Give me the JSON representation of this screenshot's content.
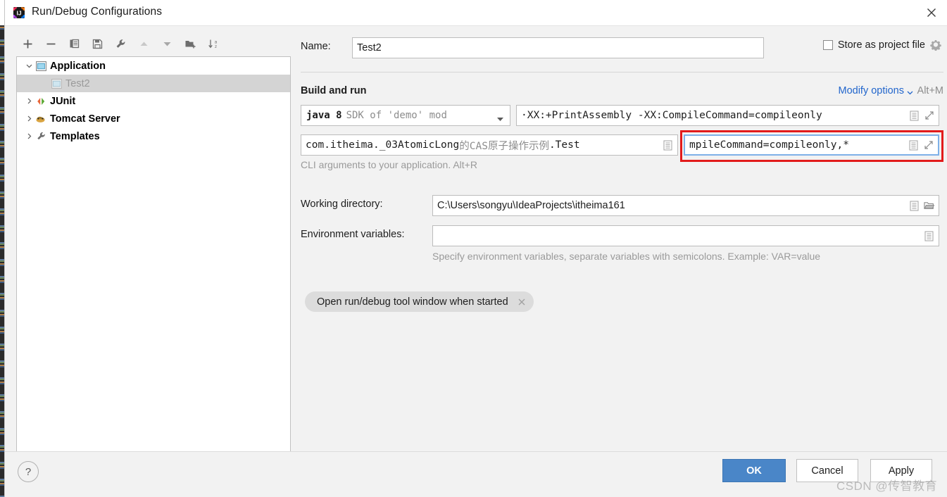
{
  "window": {
    "title": "Run/Debug Configurations",
    "app_icon": "intellij-idea-logo",
    "close_icon": "close-icon"
  },
  "toolbar": {
    "buttons": [
      {
        "name": "add-configuration-button",
        "icon": "plus-icon",
        "enabled": true
      },
      {
        "name": "remove-configuration-button",
        "icon": "minus-icon",
        "enabled": true
      },
      {
        "name": "copy-configuration-button",
        "icon": "copy-icon",
        "enabled": true
      },
      {
        "name": "save-configuration-button",
        "icon": "save-icon",
        "enabled": true
      },
      {
        "name": "edit-templates-button",
        "icon": "wrench-icon",
        "enabled": true
      },
      {
        "name": "move-up-button",
        "icon": "arrow-up-icon",
        "enabled": false
      },
      {
        "name": "move-down-button",
        "icon": "arrow-down-icon",
        "enabled": true
      },
      {
        "name": "new-folder-button",
        "icon": "folder-add-icon",
        "enabled": true
      },
      {
        "name": "sort-configurations-button",
        "icon": "sort-alpha-icon",
        "enabled": true
      }
    ]
  },
  "tree": {
    "items": [
      {
        "label": "Application",
        "icon": "application-icon",
        "expanded": true,
        "level": 0,
        "selected": false,
        "has_toggle": true
      },
      {
        "label": "Test2",
        "icon": "application-icon",
        "level": 1,
        "selected": true,
        "has_toggle": false
      },
      {
        "label": "JUnit",
        "icon": "junit-icon",
        "expanded": false,
        "level": 0,
        "selected": false,
        "has_toggle": true
      },
      {
        "label": "Tomcat Server",
        "icon": "tomcat-icon",
        "expanded": false,
        "level": 0,
        "selected": false,
        "has_toggle": true
      },
      {
        "label": "Templates",
        "icon": "wrench-icon",
        "expanded": false,
        "level": 0,
        "selected": false,
        "has_toggle": true
      }
    ]
  },
  "form": {
    "name_label": "Name:",
    "name_value": "Test2",
    "store_as_project_file_label": "Store as project file",
    "store_as_project_file_checked": false,
    "store_gear_icon": "gear-icon",
    "section_title": "Build and run",
    "modify_options_label": "Modify options",
    "modify_options_shortcut": "Alt+M",
    "jdk_value_strong": "java 8",
    "jdk_value_dim": "SDK of 'demo' mod",
    "vm_options_value": "·XX:+PrintAssembly -XX:CompileCommand=compileonly",
    "main_class_value_1": "com.itheima._03AtomicLong",
    "main_class_value_cjk": "的CAS原子操作示例",
    "main_class_value_2": ".Test",
    "program_arguments_value": "mpileCommand=compileonly,*",
    "cli_hint": "CLI arguments to your application. Alt+R",
    "working_directory_label": "Working directory:",
    "working_directory_value": "C:\\Users\\songyu\\IdeaProjects\\itheima161",
    "environment_variables_label": "Environment variables:",
    "environment_variables_value": "",
    "environment_hint": "Specify environment variables, separate variables with semicolons. Example: VAR=value",
    "chip_label": "Open run/debug tool window when started",
    "chip_close_icon": "close-small-icon",
    "expand_icon": "expand-icon",
    "list_icon": "list-icon",
    "browse_icon": "folder-browse-icon"
  },
  "footer": {
    "help_label": "?",
    "ok_label": "OK",
    "cancel_label": "Cancel",
    "apply_label": "Apply"
  },
  "watermark": "CSDN @传智教育",
  "colors": {
    "accent_blue": "#4a86c8",
    "link_blue": "#2266cc",
    "annotation_red": "#e21b1b",
    "focus_blue": "#7eb0e8",
    "dialog_bg": "#f2f2f2",
    "selection_grey": "#d4d4d4"
  }
}
